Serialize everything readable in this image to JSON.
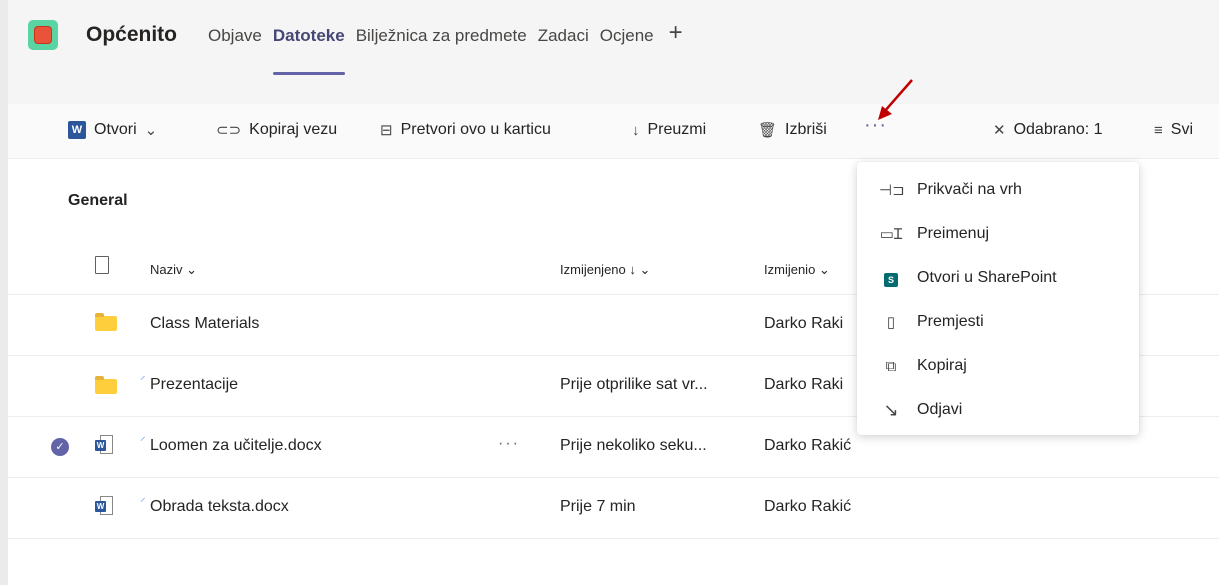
{
  "header": {
    "team_name": "Općenito",
    "tabs": [
      {
        "label": "Objave"
      },
      {
        "label": "Datoteke"
      },
      {
        "label": "Bilježnica za predmete"
      },
      {
        "label": "Zadaci"
      },
      {
        "label": "Ocjene"
      }
    ],
    "add_tab": "+"
  },
  "toolbar": {
    "open_label": "Otvori",
    "copy_link_label": "Kopiraj vezu",
    "make_tab_label": "Pretvori ovo u karticu",
    "download_label": "Preuzmi",
    "delete_label": "Izbriši",
    "more_label": "···",
    "selected_label": "Odabrano: 1",
    "all_label": "Svi"
  },
  "files": {
    "section_title": "General",
    "columns": {
      "name": "Naziv",
      "modified": "Izmijenjeno",
      "modified_by": "Izmijenio"
    },
    "rows": [
      {
        "name": "Class Materials",
        "modified": "",
        "modified_by": "Darko Raki"
      },
      {
        "name": "Prezentacije",
        "modified": "Prije otprilike sat vr...",
        "modified_by": "Darko Raki"
      },
      {
        "name": "Loomen za učitelje.docx",
        "modified": "Prije nekoliko seku...",
        "modified_by": "Darko Rakić"
      },
      {
        "name": "Obrada teksta.docx",
        "modified": "Prije 7 min",
        "modified_by": "Darko Rakić"
      }
    ]
  },
  "menu": {
    "items": [
      {
        "label": "Prikvači na vrh",
        "icon": "pin-icon"
      },
      {
        "label": "Preimenuj",
        "icon": "rename-icon"
      },
      {
        "label": "Otvori u SharePoint",
        "icon": "sharepoint-icon"
      },
      {
        "label": "Premjesti",
        "icon": "move-icon"
      },
      {
        "label": "Kopiraj",
        "icon": "copy-icon"
      },
      {
        "label": "Odjavi",
        "icon": "checkout-icon"
      }
    ]
  },
  "colors": {
    "accent": "#6264a7",
    "annotation_arrow": "#c00000"
  }
}
